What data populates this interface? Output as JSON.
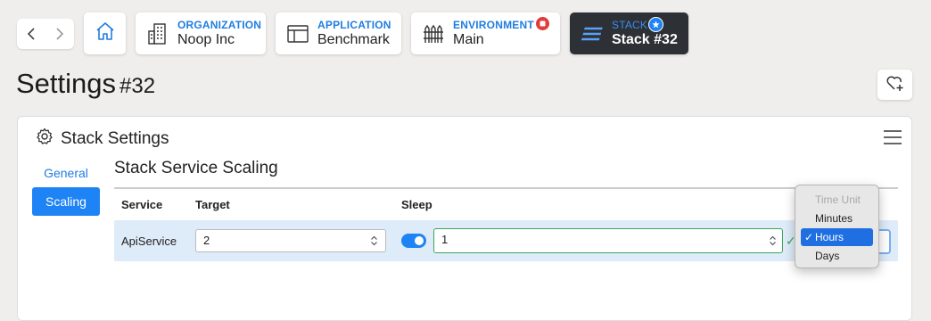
{
  "breadcrumbs": [
    {
      "label": "ORGANIZATION",
      "value": "Noop Inc"
    },
    {
      "label": "APPLICATION",
      "value": "Benchmark"
    },
    {
      "label": "ENVIRONMENT",
      "value": "Main"
    },
    {
      "label": "STACK",
      "value": "Stack #32"
    }
  ],
  "page": {
    "title": "Settings",
    "number": "#32"
  },
  "card": {
    "title": "Stack Settings"
  },
  "tabs": [
    {
      "label": "General"
    },
    {
      "label": "Scaling"
    }
  ],
  "section": {
    "title": "Stack Service Scaling"
  },
  "table": {
    "headers": [
      "Service",
      "Target",
      "Sleep"
    ],
    "rows": [
      {
        "service": "ApiService",
        "target": "2",
        "sleep_value": "1",
        "sleep_enabled": true
      }
    ]
  },
  "dropdown": {
    "options": [
      "Time Unit",
      "Minutes",
      "Hours",
      "Days"
    ],
    "selected": "Hours"
  },
  "colors": {
    "accent": "#1e84f5",
    "dark_crumb": "#2d3035",
    "valid": "#3aa657",
    "alert": "#e23b3b"
  }
}
